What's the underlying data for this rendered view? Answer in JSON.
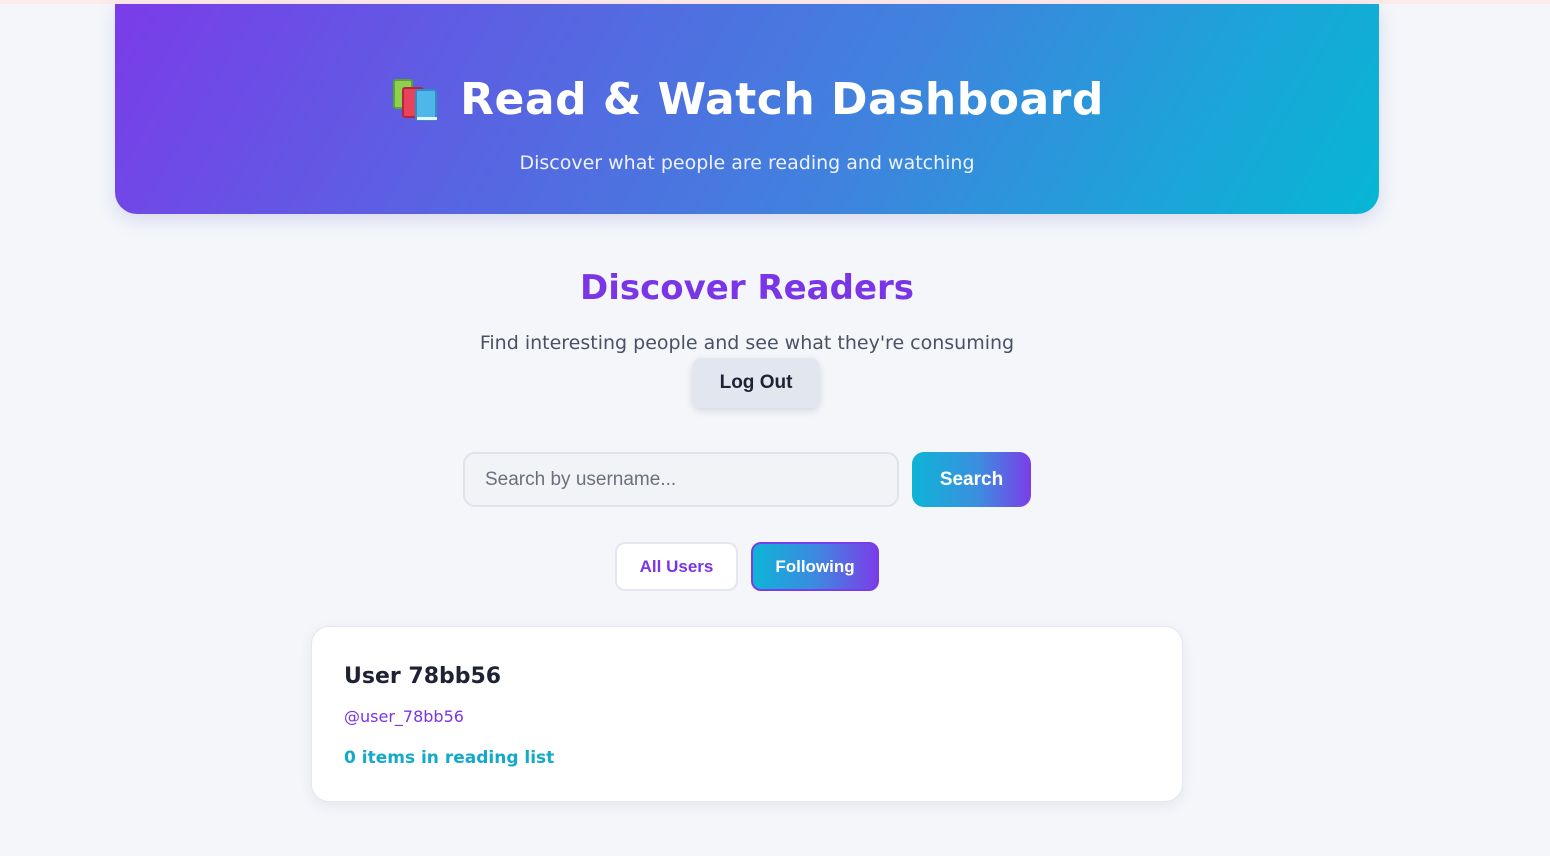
{
  "header": {
    "title": "Read & Watch Dashboard",
    "subtitle": "Discover what people are reading and watching",
    "icon": "books-icon"
  },
  "discover": {
    "title": "Discover Readers",
    "subtitle": "Find interesting people and see what they're consuming",
    "logout_label": "Log Out"
  },
  "search": {
    "placeholder": "Search by username...",
    "value": "",
    "button_label": "Search"
  },
  "filters": {
    "tabs": [
      {
        "label": "All Users",
        "active": false
      },
      {
        "label": "Following",
        "active": true
      }
    ]
  },
  "users": [
    {
      "name": "User 78bb56",
      "handle": "@user_78bb56",
      "reading_list": "0 items in reading list"
    }
  ],
  "colors": {
    "accent_purple": "#7a35e6",
    "accent_cyan": "#06b6d4",
    "background": "#f4f6fa"
  }
}
